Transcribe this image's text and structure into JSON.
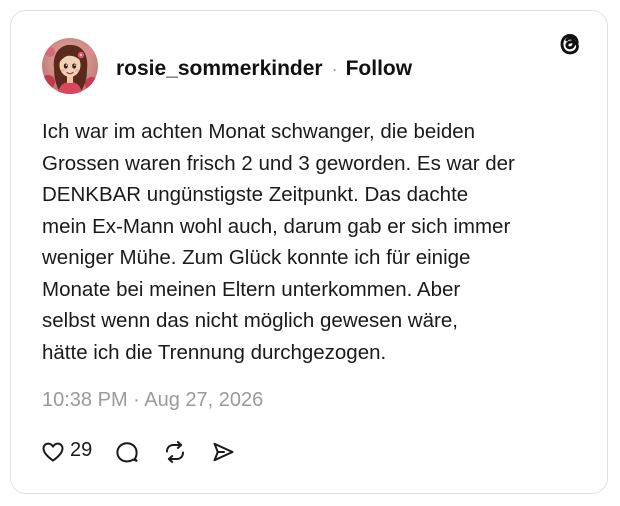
{
  "post": {
    "author": {
      "username": "rosie_sommerkinder",
      "avatar_icon": "avatar-cartoon-girl-icon"
    },
    "separator": "·",
    "follow_label": "Follow",
    "brand_icon": "threads-logo-icon",
    "text_lines": [
      "Ich war im achten Monat schwanger, die beiden",
      "Grossen waren frisch 2 und 3 geworden. Es war der",
      "DENKBAR ungünstigste Zeitpunkt. Das dachte",
      "mein Ex-Mann wohl auch, darum gab er sich immer",
      "weniger Mühe. Zum Glück konnte ich für einige",
      "Monate bei meinen Eltern unterkommen. Aber",
      "selbst wenn das nicht möglich gewesen wäre,",
      "hätte ich die Trennung durchgezogen."
    ],
    "timestamp": "10:38 PM · Aug 27, 2026",
    "actions": {
      "like_count": "29",
      "icons": [
        "heart-icon",
        "reply-icon",
        "repost-icon",
        "share-icon"
      ]
    }
  },
  "colors": {
    "text": "#1a1a1a",
    "muted": "#9a9a9a",
    "border": "#e2e2e2",
    "background": "#ffffff"
  }
}
